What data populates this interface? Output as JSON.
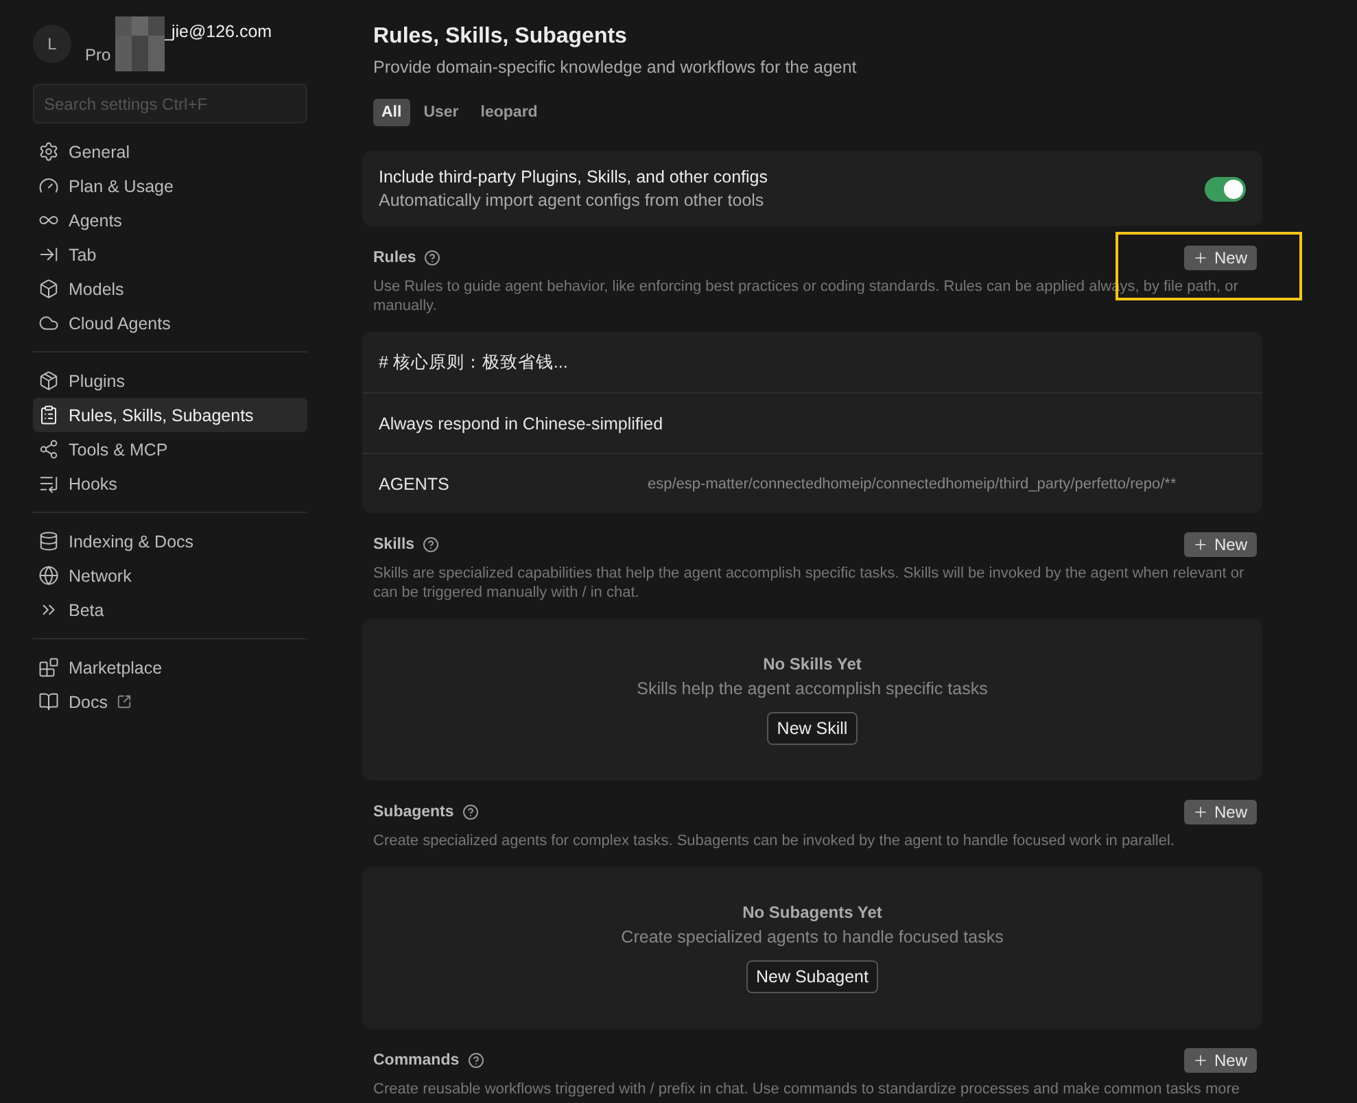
{
  "account": {
    "avatar_letter": "L",
    "email": "_jie@126.com",
    "plan": "Pro"
  },
  "search": {
    "placeholder": "Search settings Ctrl+F"
  },
  "sidebar": {
    "groups": [
      {
        "items": [
          {
            "label": "General",
            "selected": false
          },
          {
            "label": "Plan & Usage",
            "selected": false
          },
          {
            "label": "Agents",
            "selected": false
          },
          {
            "label": "Tab",
            "selected": false
          },
          {
            "label": "Models",
            "selected": false
          },
          {
            "label": "Cloud Agents",
            "selected": false
          }
        ]
      },
      {
        "items": [
          {
            "label": "Plugins",
            "selected": false
          },
          {
            "label": "Rules, Skills, Subagents",
            "selected": true
          },
          {
            "label": "Tools & MCP",
            "selected": false
          },
          {
            "label": "Hooks",
            "selected": false
          }
        ]
      },
      {
        "items": [
          {
            "label": "Indexing & Docs",
            "selected": false
          },
          {
            "label": "Network",
            "selected": false
          },
          {
            "label": "Beta",
            "selected": false
          }
        ]
      },
      {
        "items": [
          {
            "label": "Marketplace",
            "selected": false
          },
          {
            "label": "Docs",
            "selected": false,
            "external": true
          }
        ]
      }
    ]
  },
  "page": {
    "title": "Rules, Skills, Subagents",
    "subtitle": "Provide domain-specific knowledge and workflows for the agent"
  },
  "tabs": [
    {
      "label": "All",
      "selected": true
    },
    {
      "label": "User",
      "selected": false
    },
    {
      "label": "leopard",
      "selected": false
    }
  ],
  "setting": {
    "title": "Include third-party Plugins, Skills, and other configs",
    "description": "Automatically import agent configs from other tools",
    "on": true
  },
  "sections": [
    {
      "title": "Rules",
      "new_button": "New",
      "highlighted": true,
      "description": "Use Rules to guide agent behavior, like enforcing best practices or coding standards. Rules can be applied always, by file path, or manually.",
      "rules": [
        {
          "name": "# 核心原则：极致省钱..."
        },
        {
          "name": "Always respond in Chinese-simplified"
        },
        {
          "name": "AGENTS",
          "path": "esp/esp-matter/connectedhomeip/connectedhomeip/third_party/perfetto/repo/**"
        }
      ]
    },
    {
      "title": "Skills",
      "new_button": "New",
      "description": "Skills are specialized capabilities that help the agent accomplish specific tasks. Skills will be invoked by the agent when relevant or can be triggered manually with / in chat.",
      "empty": {
        "title": "No Skills Yet",
        "text": "Skills help the agent accomplish specific tasks",
        "button": "New Skill"
      }
    },
    {
      "title": "Subagents",
      "new_button": "New",
      "description": "Create specialized agents for complex tasks. Subagents can be invoked by the agent to handle focused work in parallel.",
      "empty": {
        "title": "No Subagents Yet",
        "text": "Create specialized agents to handle focused tasks",
        "button": "New Subagent"
      }
    },
    {
      "title": "Commands",
      "new_button": "New",
      "description": "Create reusable workflows triggered with / prefix in chat. Use commands to standardize processes and make common tasks more"
    }
  ]
}
